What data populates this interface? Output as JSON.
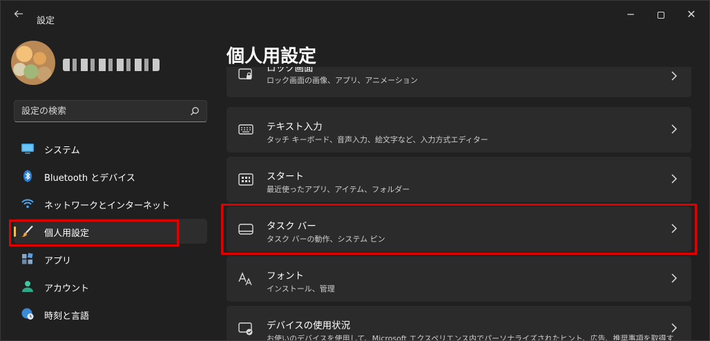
{
  "window": {
    "back_icon": "arrow-left-icon",
    "title": "設定",
    "controls": {
      "minimize": "─",
      "close": "✕"
    }
  },
  "user": {
    "name_redacted": true
  },
  "search": {
    "placeholder": "設定の検索",
    "icon": "search-icon"
  },
  "sidebar": {
    "items": [
      {
        "label": "システム",
        "icon": "display-icon",
        "active": false
      },
      {
        "label": "Bluetooth とデバイス",
        "icon": "bluetooth-icon",
        "active": false
      },
      {
        "label": "ネットワークとインターネット",
        "icon": "wifi-icon",
        "active": false
      },
      {
        "label": "個人用設定",
        "icon": "brush-icon",
        "active": true
      },
      {
        "label": "アプリ",
        "icon": "apps-icon",
        "active": false
      },
      {
        "label": "アカウント",
        "icon": "person-icon",
        "active": false
      },
      {
        "label": "時刻と言語",
        "icon": "globe-clock-icon",
        "active": false
      }
    ]
  },
  "main": {
    "title": "個人用設定",
    "cards": [
      {
        "title": "ロック画面",
        "desc": "ロック画面の画像、アプリ、アニメーション",
        "icon": "lock-screen-icon"
      },
      {
        "title": "テキスト入力",
        "desc": "タッチ キーボード、音声入力、絵文字など、入力方式エディター",
        "icon": "keyboard-icon"
      },
      {
        "title": "スタート",
        "desc": "最近使ったアプリ、アイテム、フォルダー",
        "icon": "start-grid-icon"
      },
      {
        "title": "タスク バー",
        "desc": "タスク バーの動作、システム ピン",
        "icon": "taskbar-icon"
      },
      {
        "title": "フォント",
        "desc": "インストール、管理",
        "icon": "font-icon"
      },
      {
        "title": "デバイスの使用状況",
        "desc": "お使いのデバイスを使用して、Microsoft エクスペリエンス内でパーソナライズされたヒント、広告、推奨事項を取得するために",
        "icon": "device-usage-icon"
      }
    ]
  },
  "colors": {
    "background": "#202020",
    "card": "#2b2b2b",
    "accent_indicator": "#f0c35a",
    "highlight": "#e10000"
  }
}
